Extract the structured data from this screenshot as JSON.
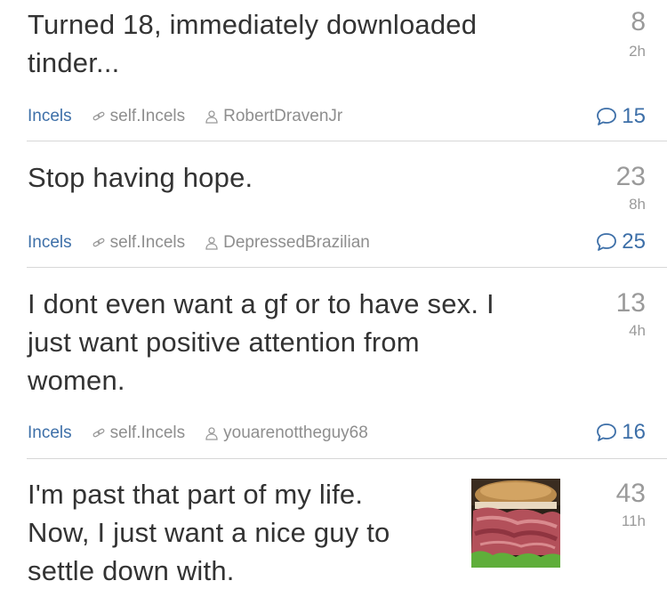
{
  "posts": [
    {
      "title_lines": [
        "Turned 18, immediately downloaded",
        "tinder..."
      ],
      "score": "8",
      "age": "2h",
      "subreddit": "Incels",
      "domain": "self.Incels",
      "author": "RobertDravenJr",
      "comments": "15"
    },
    {
      "title_lines": [
        "Stop having hope."
      ],
      "score": "23",
      "age": "8h",
      "subreddit": "Incels",
      "domain": "self.Incels",
      "author": "DepressedBrazilian",
      "comments": "25"
    },
    {
      "title_lines": [
        "I dont even want a gf or to have sex. I",
        "just want positive attention from",
        "women."
      ],
      "score": "13",
      "age": "4h",
      "subreddit": "Incels",
      "domain": "self.Incels",
      "author": "youarenottheguy68",
      "comments": "16"
    },
    {
      "title_lines": [
        "I'm past that part of my life.",
        "Now, I just want a nice guy to",
        "settle down with."
      ],
      "score": "43",
      "age": "11h",
      "thumbnail": "roast-beef-sandwich-thumbnail"
    }
  ],
  "colors": {
    "link": "#3d6fa8",
    "muted": "#9a9a9a",
    "text": "#333333"
  },
  "icons": {
    "domain": "link-icon",
    "author": "user-icon",
    "comments": "comment-bubble-icon"
  }
}
